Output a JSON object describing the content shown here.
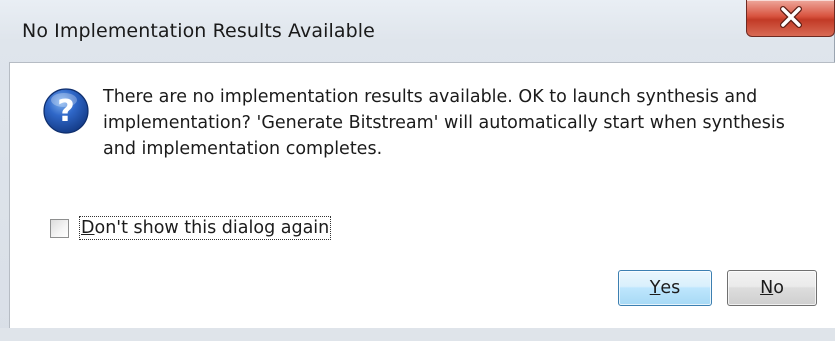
{
  "window": {
    "title": "No Implementation Results Available",
    "close_icon": "close-icon"
  },
  "dialog": {
    "icon": "question-icon",
    "message": "There are no implementation results available. OK to launch synthesis and implementation? 'Generate Bitstream' will automatically start when synthesis and implementation completes.",
    "checkbox": {
      "label_mnemonic": "D",
      "label_rest": "on't show this dialog again",
      "checked": false
    },
    "buttons": {
      "yes_mnemonic": "Y",
      "yes_rest": "es",
      "no_mnemonic": "N",
      "no_rest": "o"
    }
  },
  "colors": {
    "accent": "#3c7fb1",
    "close_red": "#c23a26",
    "icon_blue": "#1f4fa3"
  }
}
